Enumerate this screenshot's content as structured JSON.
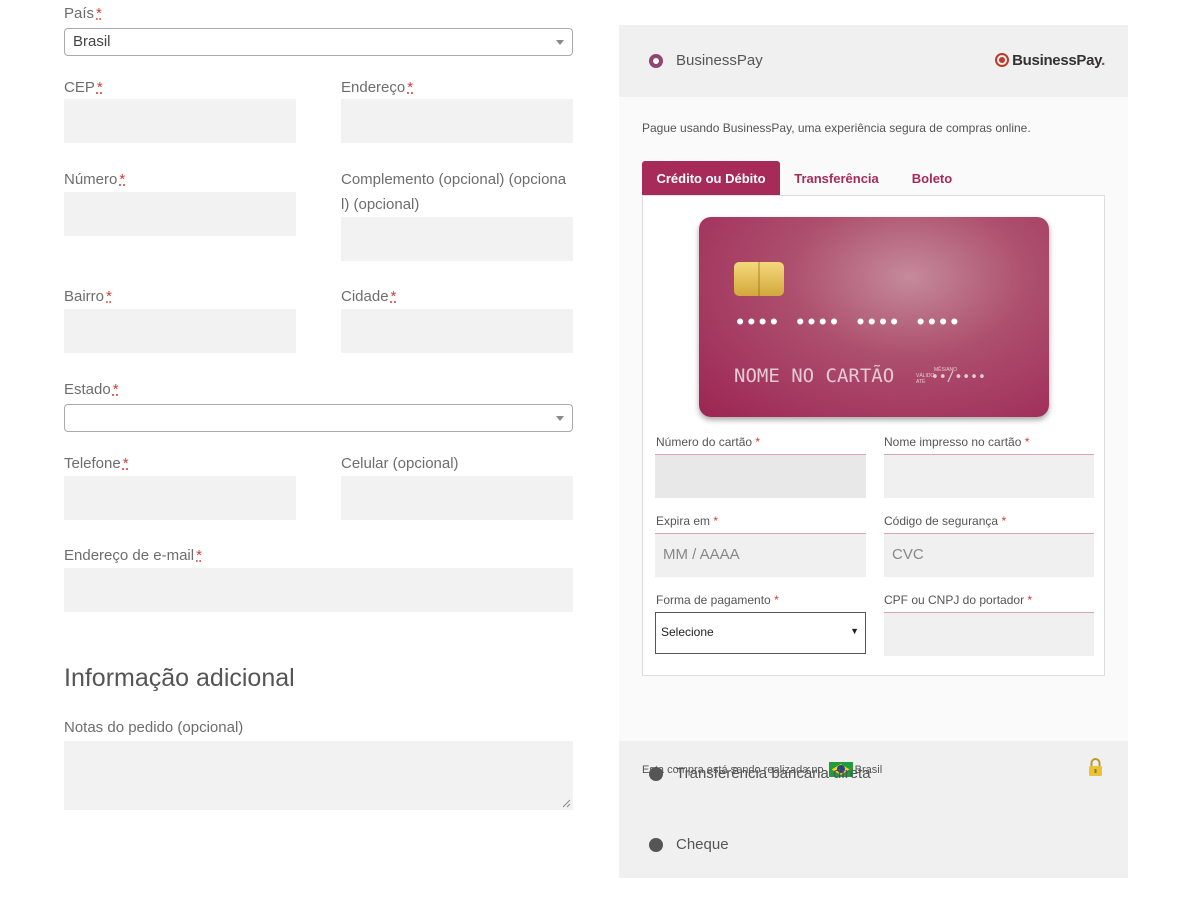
{
  "billing": {
    "country": {
      "label": "País",
      "req": "*",
      "value": "Brasil"
    },
    "cep": {
      "label": "CEP",
      "req": "*"
    },
    "address": {
      "label": "Endereço",
      "req": "*"
    },
    "number": {
      "label": "Número",
      "req": "*"
    },
    "complement": {
      "label_line1": "Complemento (opcional) (opciona",
      "label_line2": "l) (opcional)"
    },
    "neighborhood": {
      "label": "Bairro",
      "req": "*"
    },
    "city": {
      "label": "Cidade",
      "req": "*"
    },
    "state": {
      "label": "Estado",
      "req": "*",
      "value": ""
    },
    "phone": {
      "label": "Telefone",
      "req": "*"
    },
    "mobile": {
      "label": "Celular (opcional)"
    },
    "email": {
      "label": "Endereço de e-mail",
      "req": "*"
    }
  },
  "additional": {
    "heading": "Informação adicional",
    "notes_label": "Notas do pedido (opcional)"
  },
  "payment": {
    "businesspay": {
      "name": "BusinessPay",
      "brand": "BusinessPay",
      "brand_dot": ".",
      "description": "Pague usando BusinessPay, uma experiência segura de compras online.",
      "tabs": [
        "Crédito ou Débito",
        "Transferência",
        "Boleto"
      ],
      "card": {
        "number": "•••• •••• •••• ••••",
        "name": "NOME NO CARTÃO",
        "valid_label": "MÊS/ANO",
        "valid_thru": "VÁLIDO ATÉ",
        "expiry": "••/••••"
      },
      "fields": {
        "card_number": {
          "label": "Número do cartão",
          "req": "*"
        },
        "card_name": {
          "label": "Nome impresso no cartão",
          "req": "*"
        },
        "expiry": {
          "label": "Expira em",
          "req": "*",
          "placeholder": "MM / AAAA"
        },
        "cvc": {
          "label": "Código de segurança",
          "req": "*",
          "placeholder": "CVC"
        },
        "installments": {
          "label": "Forma de pagamento",
          "req": "*",
          "value": "Selecione"
        },
        "document": {
          "label": "CPF ou CNPJ do portador",
          "req": "*"
        }
      },
      "footer": {
        "prefix": "Esta compra está sendo realizada no",
        "country": "Brasil"
      }
    },
    "other_methods": [
      "Transferência bancária direta",
      "Cheque"
    ]
  },
  "colors": {
    "accent": "#a62b58",
    "radio_active": "#91456f"
  }
}
